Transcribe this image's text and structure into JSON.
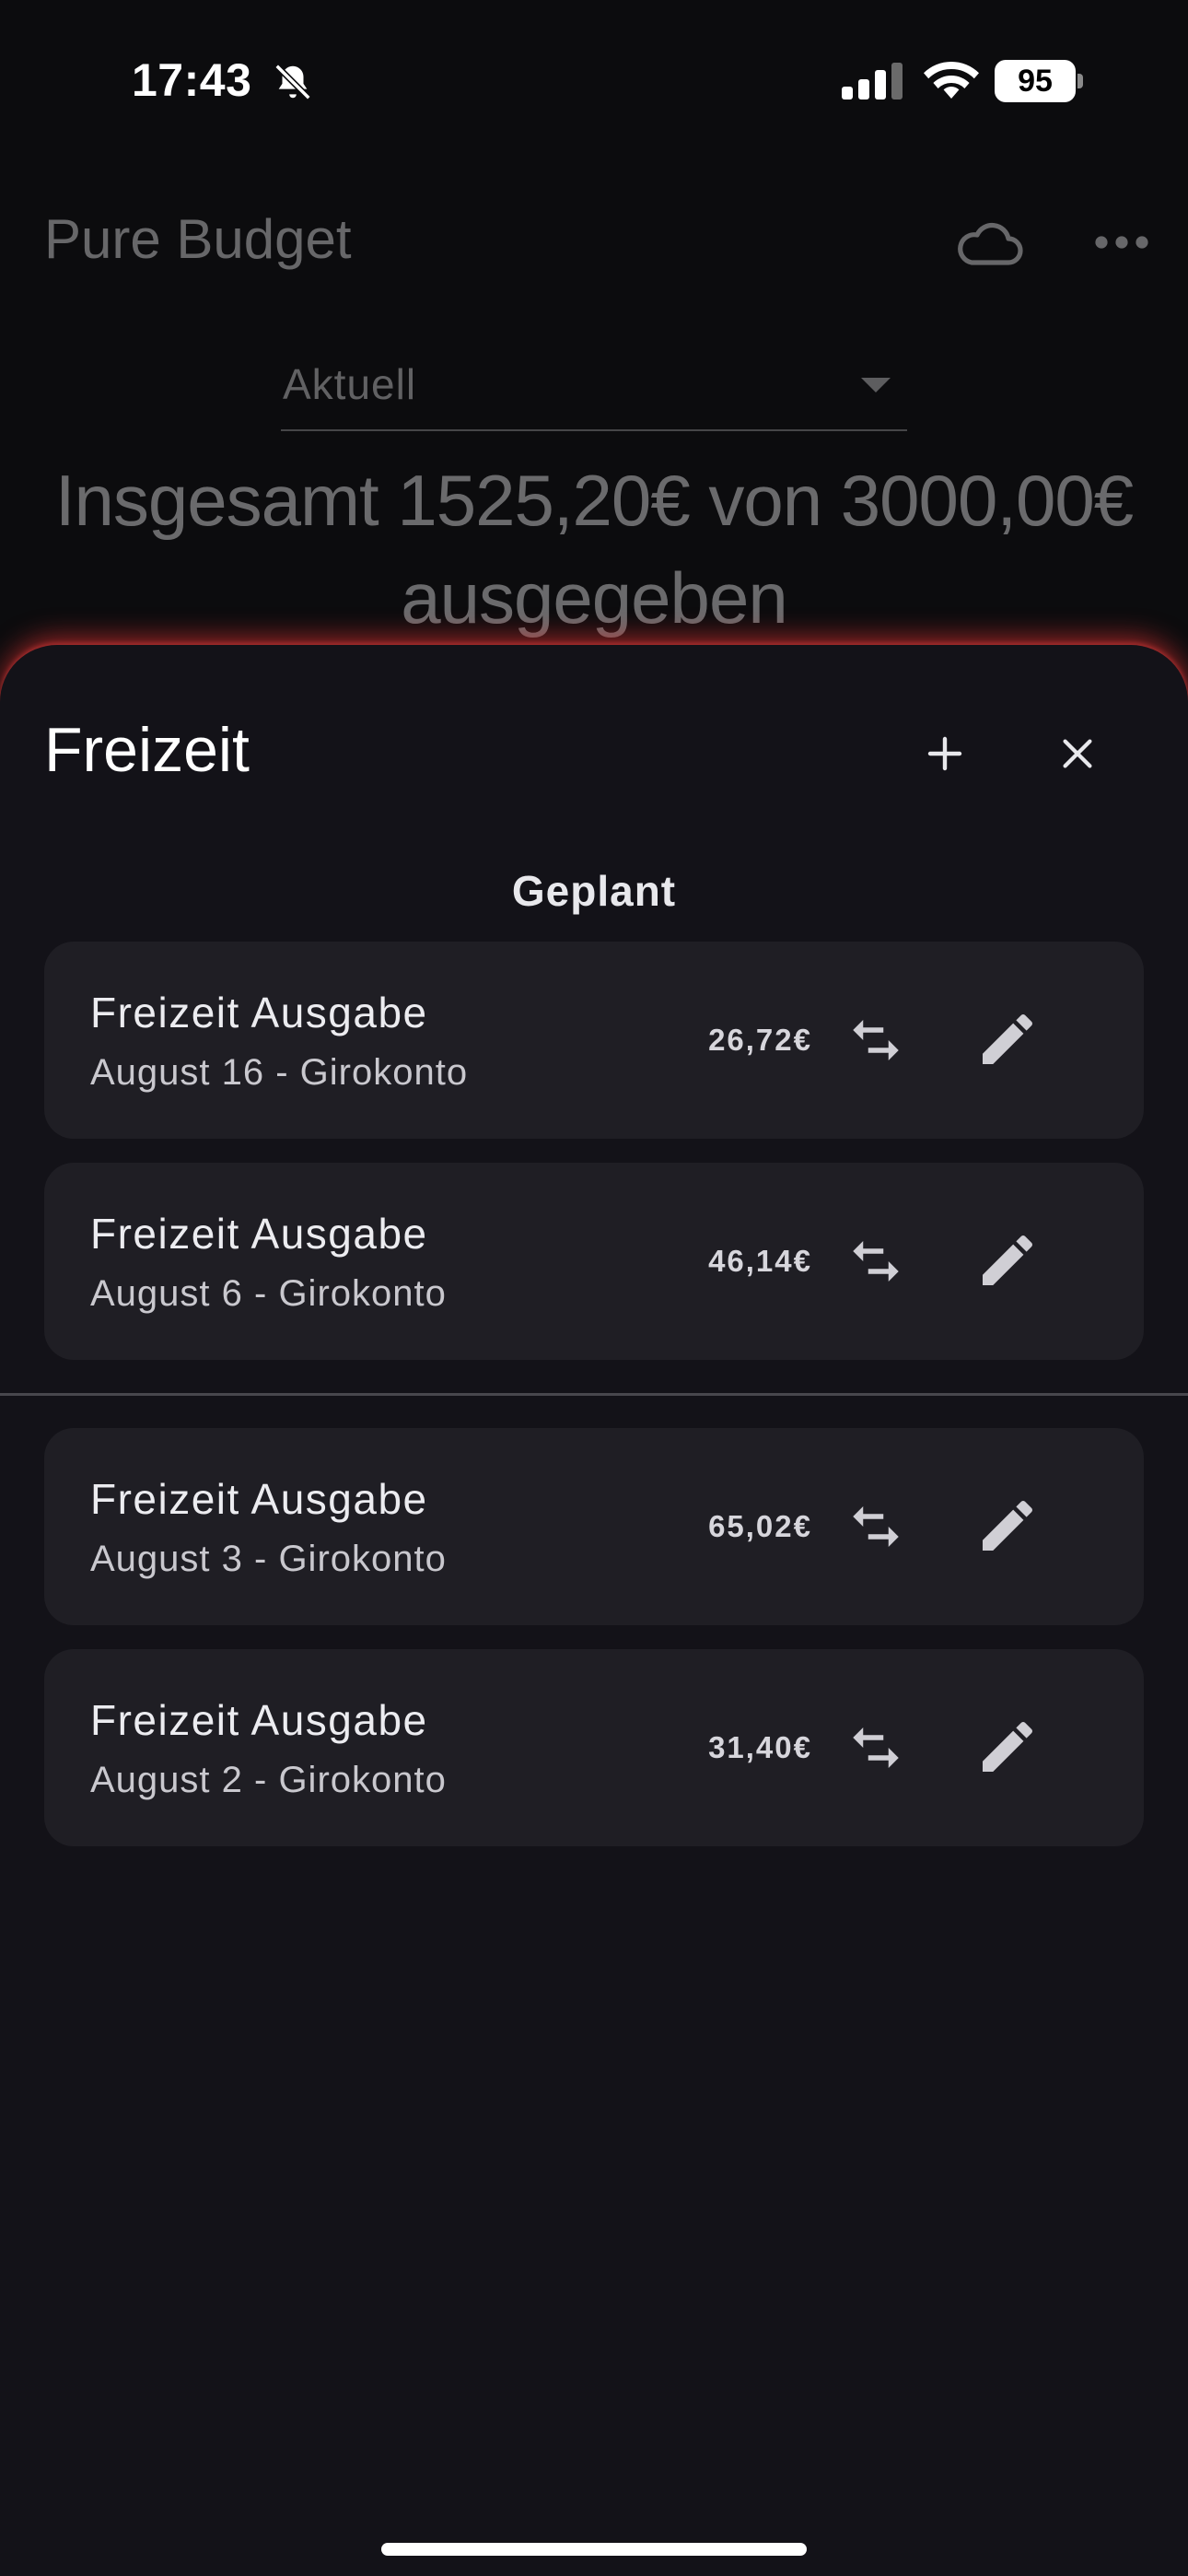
{
  "status": {
    "time": "17:43",
    "battery": "95",
    "icons": [
      "bell-slash-icon",
      "signal-icon",
      "wifi-icon",
      "battery-icon"
    ]
  },
  "header": {
    "app_title": "Pure Budget",
    "icons": [
      "cloud-icon",
      "more-icon"
    ]
  },
  "period": {
    "selected": "Aktuell"
  },
  "summary": {
    "line1": "Insgesamt 1525,20€ von 3000,00€",
    "line2": "ausgegeben"
  },
  "sheet": {
    "title": "Freizeit",
    "section_title": "Geplant",
    "icons": [
      "add-icon",
      "close-icon",
      "swap-icon",
      "edit-icon"
    ],
    "planned": [
      {
        "name": "Freizeit Ausgabe",
        "subtitle": "August 16 - Girokonto",
        "amount": "26,72€"
      },
      {
        "name": "Freizeit Ausgabe",
        "subtitle": "August 6 - Girokonto",
        "amount": "46,14€"
      }
    ],
    "past": [
      {
        "name": "Freizeit Ausgabe",
        "subtitle": "August 3 - Girokonto",
        "amount": "65,02€"
      },
      {
        "name": "Freizeit Ausgabe",
        "subtitle": "August 2 - Girokonto",
        "amount": "31,40€"
      }
    ]
  },
  "colors": {
    "sheet_bg": "#131218",
    "card_bg": "#1f1e24",
    "glow": "#c82d2d"
  }
}
